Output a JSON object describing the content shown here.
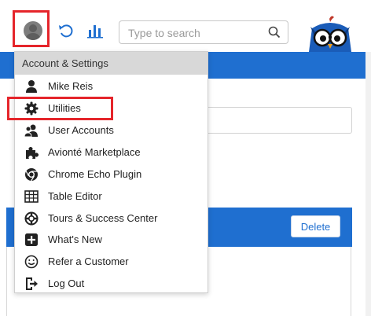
{
  "header": {
    "search": {
      "placeholder": "Type to search",
      "value": ""
    }
  },
  "menu": {
    "title": "Account & Settings",
    "items": [
      {
        "label": "Mike Reis",
        "icon": "user-icon"
      },
      {
        "label": "Utilities",
        "icon": "gear-icon"
      },
      {
        "label": "User Accounts",
        "icon": "users-icon"
      },
      {
        "label": "Avionté Marketplace",
        "icon": "puzzle-icon"
      },
      {
        "label": "Chrome Echo Plugin",
        "icon": "chrome-icon"
      },
      {
        "label": "Table Editor",
        "icon": "table-icon"
      },
      {
        "label": "Tours & Success Center",
        "icon": "lifebuoy-icon"
      },
      {
        "label": "What's New",
        "icon": "plus-square-icon"
      },
      {
        "label": "Refer a Customer",
        "icon": "smile-icon"
      },
      {
        "label": "Log Out",
        "icon": "logout-icon"
      }
    ]
  },
  "panel": {
    "delete_label": "Delete"
  },
  "colors": {
    "brand_blue": "#1f6fd0",
    "highlight_red": "#e5252b",
    "menu_header_bg": "#d8d8d8"
  }
}
